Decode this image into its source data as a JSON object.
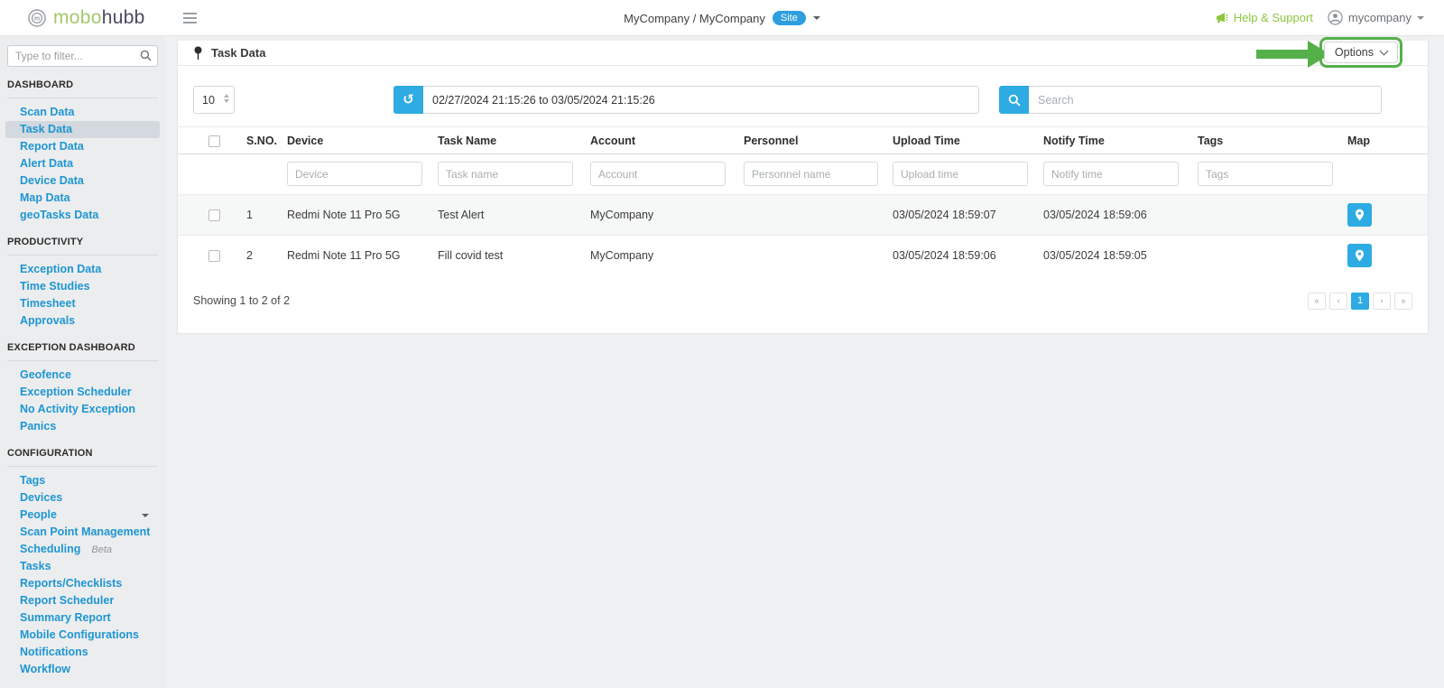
{
  "header": {
    "logo_mobo": "mobo",
    "logo_hubb": "hubb",
    "breadcrumb": "MyCompany / MyCompany",
    "site_badge": "Site",
    "help_label": "Help & Support",
    "account_label": "mycompany"
  },
  "colors": {
    "accent_blue": "#2dabe2",
    "link_blue": "#1d96d2",
    "annotation_green": "#55b04a",
    "help_green": "#8dc63f",
    "logo_green": "#a5c96a",
    "badge_blue": "#2d9fdf"
  },
  "icons": {
    "logo": "mobohubb-logo-icon",
    "menu": "hamburger-icon",
    "help": "megaphone-icon",
    "account": "person-icon",
    "title": "pin-icon",
    "refresh": "refresh-icon",
    "search": "search-icon",
    "map": "map-marker-icon"
  },
  "sidebar": {
    "filter_placeholder": "Type to filter...",
    "sections": [
      {
        "title": "DASHBOARD",
        "items": [
          {
            "label": "Scan Data"
          },
          {
            "label": "Task Data",
            "active": true
          },
          {
            "label": "Report Data"
          },
          {
            "label": "Alert Data"
          },
          {
            "label": "Device Data"
          },
          {
            "label": "Map Data"
          },
          {
            "label": "geoTasks Data"
          }
        ]
      },
      {
        "title": "PRODUCTIVITY",
        "items": [
          {
            "label": "Exception Data"
          },
          {
            "label": "Time Studies"
          },
          {
            "label": "Timesheet"
          },
          {
            "label": "Approvals"
          }
        ]
      },
      {
        "title": "EXCEPTION DASHBOARD",
        "items": [
          {
            "label": "Geofence"
          },
          {
            "label": "Exception Scheduler"
          },
          {
            "label": "No Activity Exception"
          },
          {
            "label": "Panics"
          }
        ]
      },
      {
        "title": "CONFIGURATION",
        "items": [
          {
            "label": "Tags"
          },
          {
            "label": "Devices"
          },
          {
            "label": "People",
            "caret": true
          },
          {
            "label": "Scan Point Management"
          },
          {
            "label": "Scheduling",
            "badge": "Beta"
          },
          {
            "label": "Tasks"
          },
          {
            "label": "Reports/Checklists"
          },
          {
            "label": "Report Scheduler"
          },
          {
            "label": "Summary Report"
          },
          {
            "label": "Mobile Configurations"
          },
          {
            "label": "Notifications"
          },
          {
            "label": "Workflow"
          }
        ]
      }
    ]
  },
  "main": {
    "title": "Task Data",
    "options_label": "Options",
    "page_size": "10",
    "date_range": "02/27/2024 21:15:26 to 03/05/2024 21:15:26",
    "search_placeholder": "Search",
    "table": {
      "headers": [
        "S.NO.",
        "Device",
        "Task Name",
        "Account",
        "Personnel",
        "Upload Time",
        "Notify Time",
        "Tags",
        "Map"
      ],
      "filter_placeholders": [
        "Device",
        "Task name",
        "Account",
        "Personnel name",
        "Upload time",
        "Notify time",
        "Tags"
      ],
      "rows": [
        {
          "sno": "1",
          "device": "Redmi Note 11 Pro 5G",
          "task": "Test Alert",
          "account": "MyCompany",
          "personnel": "",
          "upload": "03/05/2024 18:59:07",
          "notify": "03/05/2024 18:59:06",
          "tags": ""
        },
        {
          "sno": "2",
          "device": "Redmi Note 11 Pro 5G",
          "task": "Fill covid test",
          "account": "MyCompany",
          "personnel": "",
          "upload": "03/05/2024 18:59:06",
          "notify": "03/05/2024 18:59:05",
          "tags": ""
        }
      ]
    },
    "footer": {
      "showing": "Showing 1 to 2 of 2",
      "pagination": [
        "«",
        "‹",
        "1",
        "›",
        "»"
      ]
    }
  }
}
